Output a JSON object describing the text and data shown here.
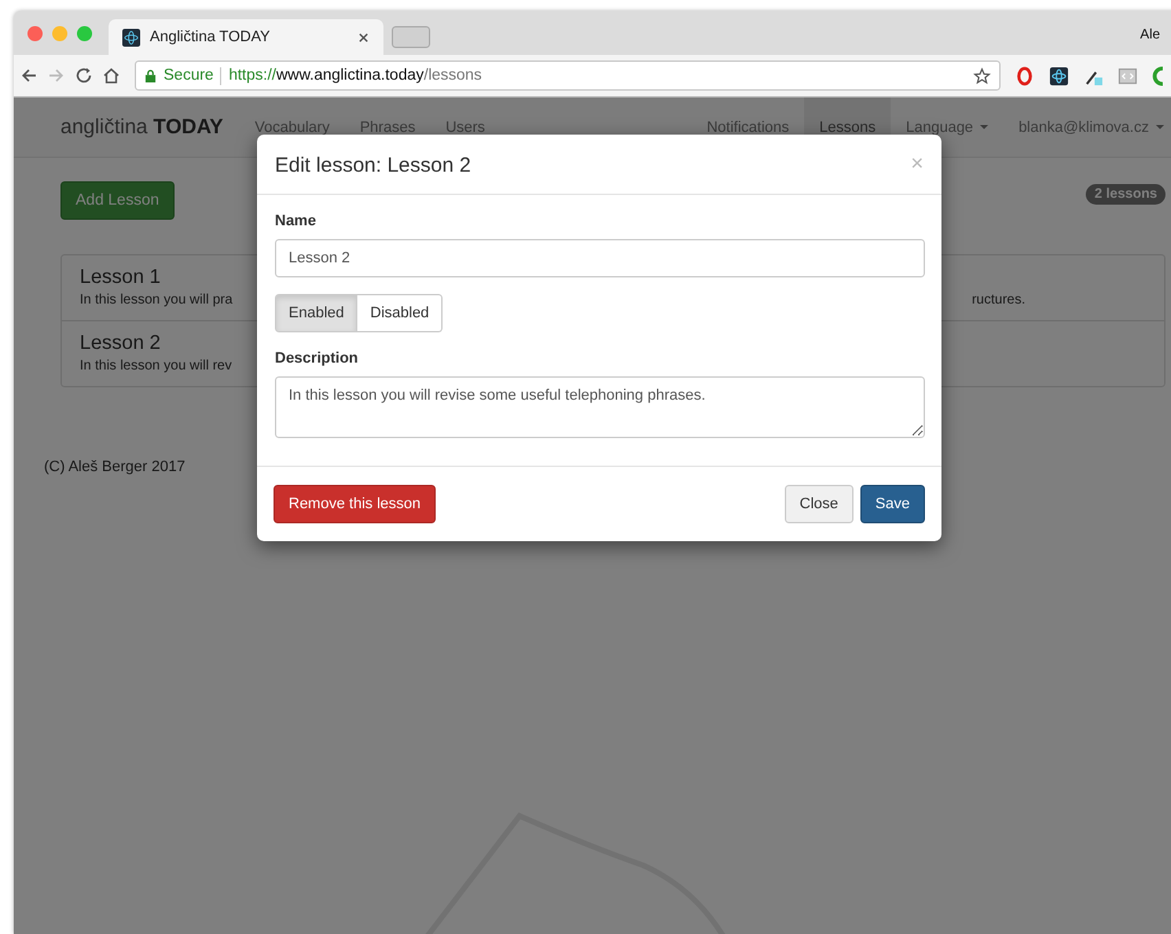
{
  "browser": {
    "tab_title": "Angličtina TODAY",
    "profile": "Ale",
    "secure_label": "Secure",
    "url_scheme": "https://",
    "url_host": "www.anglictina.today",
    "url_path": "/lessons"
  },
  "navbar": {
    "brand_light": "angličtina",
    "brand_bold": "TODAY",
    "left_items": [
      {
        "label": "Vocabulary",
        "selected": false
      },
      {
        "label": "Phrases",
        "selected": false
      },
      {
        "label": "Users",
        "selected": false
      }
    ],
    "right_items": [
      {
        "label": "Notifications",
        "selected": false,
        "dropdown": false
      },
      {
        "label": "Lessons",
        "selected": true,
        "dropdown": false
      },
      {
        "label": "Language",
        "selected": false,
        "dropdown": true
      },
      {
        "label": "blanka@klimova.cz",
        "selected": false,
        "dropdown": true
      }
    ]
  },
  "add_button": "Add Lesson",
  "count_badge": "2 lessons",
  "lessons": [
    {
      "title": "Lesson 1",
      "description_visible_left": "In this lesson you will pra",
      "description_visible_right": "ructures."
    },
    {
      "title": "Lesson 2",
      "description_visible_left": "In this lesson you will rev"
    }
  ],
  "footer": "(C) Aleš Berger 2017",
  "modal": {
    "title": "Edit lesson: Lesson 2",
    "close": "×",
    "name_label": "Name",
    "name_value": "Lesson 2",
    "status_options": [
      {
        "label": "Enabled",
        "selected": true
      },
      {
        "label": "Disabled",
        "selected": false
      }
    ],
    "description_label": "Description",
    "description_value": "In this lesson you will revise some useful telephoning phrases.",
    "remove_button": "Remove this lesson",
    "close_button": "Close",
    "save_button": "Save"
  }
}
